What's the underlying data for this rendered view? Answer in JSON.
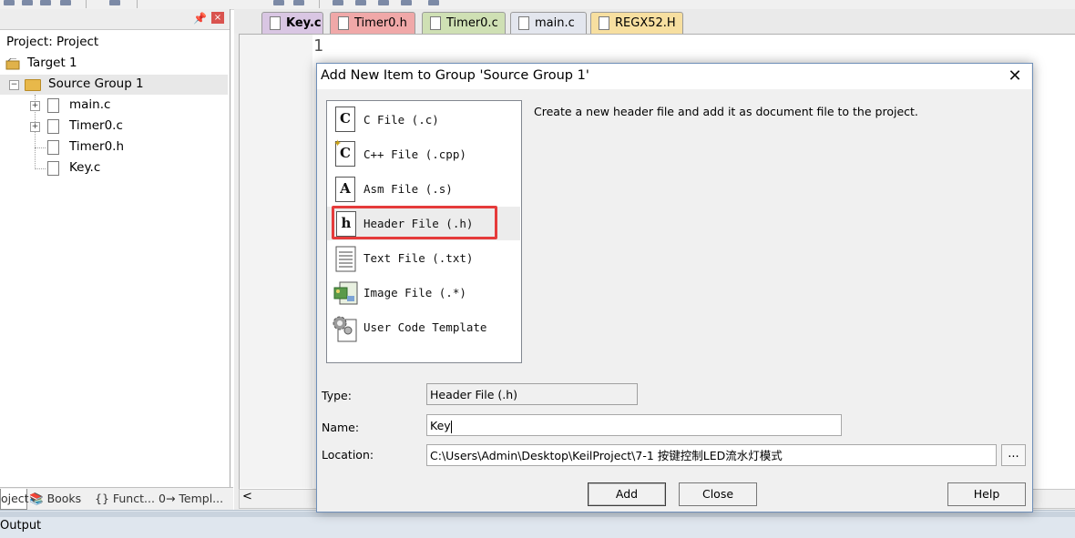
{
  "project_panel": {
    "title_pin": "ᵖ",
    "close": "×",
    "tree": {
      "root": "Project: Project",
      "target": "Target 1",
      "group": "Source Group 1",
      "files": [
        "main.c",
        "Timer0.c",
        "Timer0.h",
        "Key.c"
      ]
    },
    "bottom_tabs": [
      {
        "label": "oject"
      },
      {
        "label": "Books"
      },
      {
        "label": "{} Funct..."
      },
      {
        "label": "0→ Templ..."
      }
    ]
  },
  "editor": {
    "tabs": [
      {
        "label": "Key.c",
        "color": "#d9c6e3"
      },
      {
        "label": "Timer0.h",
        "color": "#f0a8a8"
      },
      {
        "label": "Timer0.c",
        "color": "#cfe0b4"
      },
      {
        "label": "main.c",
        "color": "#e3e6ee"
      },
      {
        "label": "REGX52.H",
        "color": "#f7dfa0"
      }
    ],
    "line_number": "1",
    "scroll_left": "<"
  },
  "dialog": {
    "title": "Add New Item to Group 'Source Group 1'",
    "close": "✕",
    "items": [
      {
        "icon": "C",
        "label": "C File (.c)"
      },
      {
        "icon": "C",
        "label": "C++ File (.cpp)"
      },
      {
        "icon": "A",
        "label": "Asm File (.s)"
      },
      {
        "icon": "h",
        "label": "Header File (.h)"
      },
      {
        "icon": "",
        "label": "Text File (.txt)"
      },
      {
        "icon": "",
        "label": "Image File (.*)"
      },
      {
        "icon": "",
        "label": "User Code Template"
      }
    ],
    "description": "Create a new header file and add it as document file to the project.",
    "type_label": "Type:",
    "type_value": "Header File (.h)",
    "name_label": "Name:",
    "name_value": "Key",
    "location_label": "Location:",
    "location_value": "C:\\Users\\Admin\\Desktop\\KeilProject\\7-1 按键控制LED流水灯模式",
    "browse": "...",
    "add_button": "Add",
    "close_button": "Close",
    "help_button": "Help"
  },
  "status": {
    "output": "Output"
  },
  "colors": {
    "highlight": "#e53b3b",
    "dialog_border": "#6f8fb8"
  }
}
